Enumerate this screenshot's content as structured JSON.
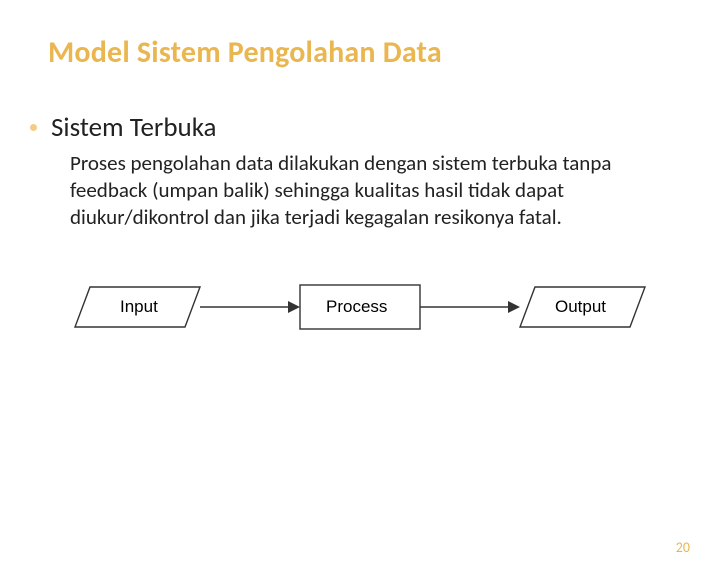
{
  "title": "Model Sistem Pengolahan Data",
  "bullet": {
    "heading": "Sistem Terbuka"
  },
  "body": "Proses pengolahan data dilakukan dengan sistem terbuka tanpa feedback (umpan balik) sehingga kualitas hasil tidak dapat diukur/dikontrol dan jika terjadi kegagalan resikonya fatal.",
  "diagram": {
    "nodes": {
      "input": {
        "label": "Input"
      },
      "process": {
        "label": "Process"
      },
      "output": {
        "label": "Output"
      }
    }
  },
  "page_number": "20"
}
